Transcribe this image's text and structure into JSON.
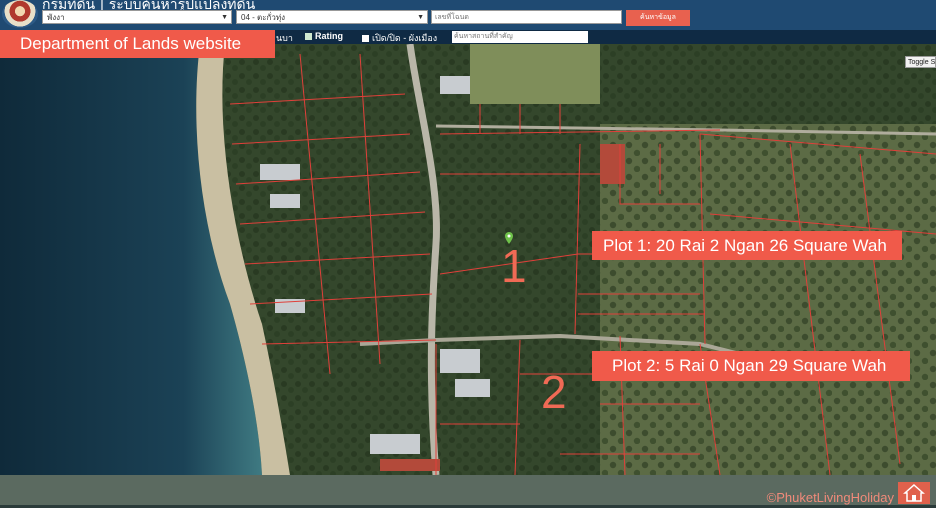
{
  "header": {
    "site_title": "กรมที่ดิน | ระบบค้นหารูปแปลงที่ดิน",
    "province_selected": "พังงา",
    "district_selected": "04 - ตะกั่วทุ่ง",
    "deed_placeholder": "เลขที่โฉนด",
    "search_button": "ค้นหาข้อมูล"
  },
  "toolbar": {
    "layer_fragment": "นบา",
    "rating_label": "Rating",
    "toggle_city_plan_label": "เปิด/ปิด - ผังเมือง",
    "landmark_placeholder": "ค้นหาสถานที่สำคัญ"
  },
  "map": {
    "toggle_label": "Toggle S",
    "plot_1_number": "1",
    "plot_2_number": "2"
  },
  "annotations": {
    "dol_website": "Department of Lands website",
    "plot_1": "Plot 1: 20 Rai 2 Ngan 26 Square Wah",
    "plot_2": "Plot 2: 5 Rai 0 Ngan 29 Square Wah"
  },
  "footer": {
    "copyright": "©PhuketLivingHoliday"
  },
  "colors": {
    "header_bg": "#1f4a72",
    "toolbar_bg": "#0f2a44",
    "accent_red": "#f05a4a",
    "parcel_line": "#e0403a",
    "sea": "#17364a",
    "footer_bg": "#5b6a60"
  },
  "icons": [
    "seal-logo",
    "map-pin-icon",
    "home-icon",
    "checkbox-icon"
  ]
}
